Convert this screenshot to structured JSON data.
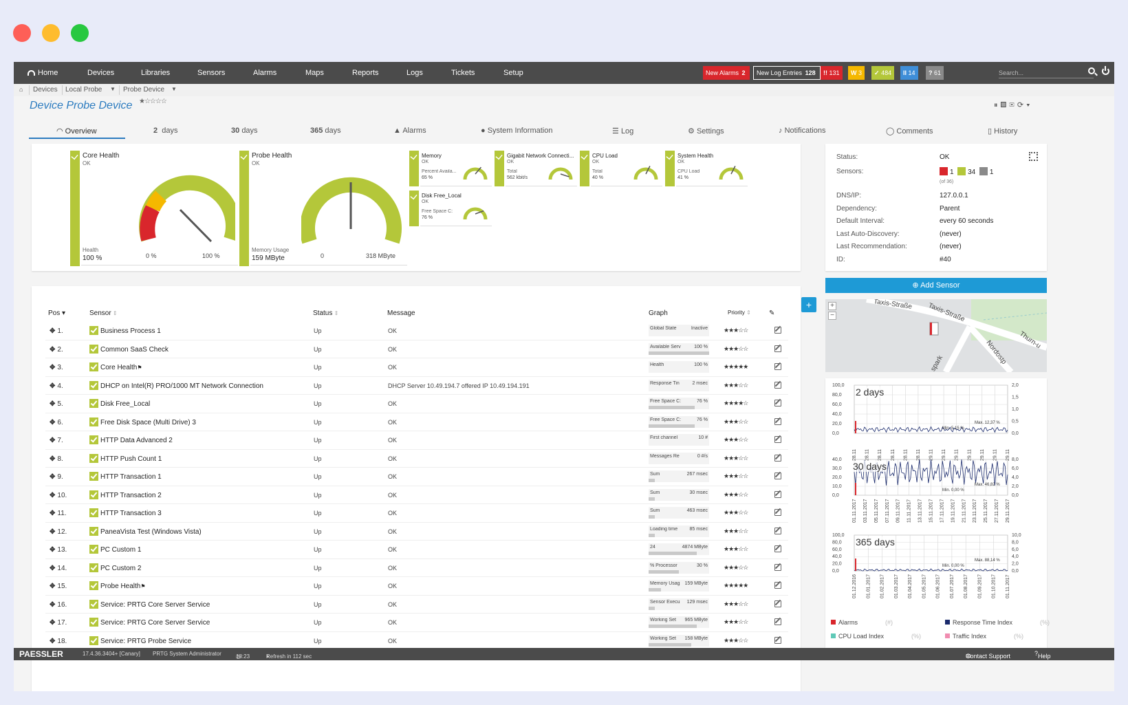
{
  "nav": {
    "items": [
      "Home",
      "Devices",
      "Libraries",
      "Sensors",
      "Alarms",
      "Maps",
      "Reports",
      "Logs",
      "Tickets",
      "Setup"
    ],
    "new_alarms_label": "New Alarms",
    "new_alarms_count": "2",
    "new_log_label": "New Log Entries",
    "new_log_count": "128",
    "badges": [
      {
        "symbol": "!!",
        "count": "131",
        "color": "#d9262c"
      },
      {
        "symbol": "W",
        "count": "3",
        "color": "#f5b800"
      },
      {
        "symbol": "✓",
        "count": "484",
        "color": "#b4c73a"
      },
      {
        "symbol": "II",
        "count": "14",
        "color": "#3f8ed8"
      },
      {
        "symbol": "?",
        "count": "61",
        "color": "#8a8a8a"
      }
    ],
    "search_placeholder": "Search..."
  },
  "breadcrumb": [
    "Devices",
    "Local Probe",
    "Probe Device"
  ],
  "page": {
    "title": "Device Probe Device",
    "stars": "★☆☆☆☆"
  },
  "tabs": [
    {
      "label": "Overview",
      "icon": "gauge-icon"
    },
    {
      "num": "2",
      "label": "days"
    },
    {
      "num": "30",
      "label": "days"
    },
    {
      "num": "365",
      "label": "days"
    },
    {
      "label": "Alarms",
      "icon": "warning-icon"
    },
    {
      "label": "System Information",
      "icon": "info-icon"
    },
    {
      "label": "Log",
      "icon": "list-icon"
    },
    {
      "label": "Settings",
      "icon": "gear-icon"
    },
    {
      "label": "Notifications",
      "icon": "bell-icon"
    },
    {
      "label": "Comments",
      "icon": "comment-icon"
    },
    {
      "label": "History",
      "icon": "history-icon"
    }
  ],
  "gauges_big": [
    {
      "name": "Core Health",
      "status": "OK",
      "channel": "Health",
      "value": "100 %",
      "min": "0 %",
      "max": "100 %",
      "fraction": 1.0
    },
    {
      "name": "Probe Health",
      "status": "OK",
      "channel": "Memory Usage",
      "value": "159 MByte",
      "min": "0",
      "max": "318 MByte",
      "fraction": 0.5
    }
  ],
  "gauges_small": [
    {
      "name": "Memory",
      "status": "OK",
      "channel": "Percent Availa...",
      "value": "65 %",
      "fraction": 0.65
    },
    {
      "name": "Gigabit Network Connecti...",
      "status": "OK",
      "channel": "Total",
      "value": "562 kbit/s",
      "fraction": 0.9
    },
    {
      "name": "CPU Load",
      "status": "OK",
      "channel": "Total",
      "value": "40 %",
      "fraction": 0.6
    },
    {
      "name": "System Health",
      "status": "OK",
      "channel": "CPU Load",
      "value": "41 %",
      "fraction": 0.6
    },
    {
      "name": "Disk Free_Local",
      "status": "OK",
      "channel": "Free Space C:",
      "value": "76 %",
      "fraction": 0.76
    }
  ],
  "table": {
    "headers": {
      "pos": "Pos",
      "sensor": "Sensor",
      "status": "Status",
      "message": "Message",
      "graph": "Graph",
      "priority": "Priority"
    },
    "rows": [
      {
        "pos": "1.",
        "name": "Business Process 1",
        "flag": "",
        "status": "Up",
        "message": "OK",
        "ch": "Global State",
        "val": "Inactive",
        "fill": 0,
        "prio": "★★★☆☆"
      },
      {
        "pos": "2.",
        "name": "Common SaaS Check",
        "flag": "",
        "status": "Up",
        "message": "OK",
        "ch": "Available Serv",
        "val": "100 %",
        "fill": 1,
        "prio": "★★★☆☆"
      },
      {
        "pos": "3.",
        "name": "Core Health",
        "flag": "⚑",
        "status": "Up",
        "message": "OK",
        "ch": "Health",
        "val": "100 %",
        "fill": 0,
        "prio": "★★★★★"
      },
      {
        "pos": "4.",
        "name": "DHCP on Intel(R) PRO/1000 MT Network Connection",
        "flag": "",
        "status": "Up",
        "message": "DHCP Server 10.49.194.7 offered IP 10.49.194.191",
        "ch": "Response Tin",
        "val": "2 msec",
        "fill": 0,
        "prio": "★★★☆☆"
      },
      {
        "pos": "5.",
        "name": "Disk Free_Local",
        "flag": "",
        "status": "Up",
        "message": "OK",
        "ch": "Free Space C:",
        "val": "76 %",
        "fill": 0.76,
        "prio": "★★★★☆"
      },
      {
        "pos": "6.",
        "name": "Free Disk Space (Multi Drive) 3",
        "flag": "",
        "status": "Up",
        "message": "OK",
        "ch": "Free Space C:",
        "val": "76 %",
        "fill": 0.76,
        "prio": "★★★☆☆"
      },
      {
        "pos": "7.",
        "name": "HTTP Data Advanced 2",
        "flag": "",
        "status": "Up",
        "message": "OK",
        "ch": "First channel",
        "val": "10 #",
        "fill": 0,
        "prio": "★★★☆☆"
      },
      {
        "pos": "8.",
        "name": "HTTP Push Count 1",
        "flag": "",
        "status": "Up",
        "message": "OK",
        "ch": "Messages Re",
        "val": "0 #/s",
        "fill": 0,
        "prio": "★★★☆☆"
      },
      {
        "pos": "9.",
        "name": "HTTP Transaction 1",
        "flag": "",
        "status": "Up",
        "message": "OK",
        "ch": "Sum",
        "val": "267 msec",
        "fill": 0.1,
        "prio": "★★★☆☆"
      },
      {
        "pos": "10.",
        "name": "HTTP Transaction 2",
        "flag": "",
        "status": "Up",
        "message": "OK",
        "ch": "Sum",
        "val": "30 msec",
        "fill": 0.1,
        "prio": "★★★☆☆"
      },
      {
        "pos": "11.",
        "name": "HTTP Transaction 3",
        "flag": "",
        "status": "Up",
        "message": "OK",
        "ch": "Sum",
        "val": "463 msec",
        "fill": 0.1,
        "prio": "★★★☆☆"
      },
      {
        "pos": "12.",
        "name": "PaneaVista Test (Windows Vista)",
        "flag": "",
        "status": "Up",
        "message": "OK",
        "ch": "Loading time",
        "val": "85 msec",
        "fill": 0.1,
        "prio": "★★★☆☆"
      },
      {
        "pos": "13.",
        "name": "PC Custom 1",
        "flag": "",
        "status": "Up",
        "message": "OK",
        "ch": "24",
        "val": "4874 MByte",
        "fill": 0.8,
        "prio": "★★★☆☆"
      },
      {
        "pos": "14.",
        "name": "PC Custom 2",
        "flag": "",
        "status": "Up",
        "message": "OK",
        "ch": "% Processor",
        "val": "30 %",
        "fill": 0.5,
        "prio": "★★★☆☆"
      },
      {
        "pos": "15.",
        "name": "Probe Health",
        "flag": "⚑",
        "status": "Up",
        "message": "OK",
        "ch": "Memory Usag",
        "val": "159 MByte",
        "fill": 0.2,
        "prio": "★★★★★"
      },
      {
        "pos": "16.",
        "name": "Service: PRTG Core Server Service",
        "flag": "",
        "status": "Up",
        "message": "OK",
        "ch": "Sensor Execu",
        "val": "129 msec",
        "fill": 0.1,
        "prio": "★★★☆☆"
      },
      {
        "pos": "17.",
        "name": "Service: PRTG Core Server Service",
        "flag": "",
        "status": "Up",
        "message": "OK",
        "ch": "Working Set",
        "val": "965 MByte",
        "fill": 0.8,
        "prio": "★★★☆☆"
      },
      {
        "pos": "18.",
        "name": "Service: PRTG Probe Service",
        "flag": "",
        "status": "Up",
        "message": "OK",
        "ch": "Working Set",
        "val": "158 MByte",
        "fill": 0.7,
        "prio": "★★★☆☆"
      }
    ]
  },
  "info": {
    "status_label": "Status:",
    "status_value": "OK",
    "sensors_label": "Sensors:",
    "sensors_down": "1",
    "sensors_up": "34",
    "sensors_unknown": "1",
    "sensors_total": "(of 36)",
    "rows": [
      {
        "k": "DNS/IP:",
        "v": "127.0.0.1"
      },
      {
        "k": "Dependency:",
        "v": "Parent"
      },
      {
        "k": "Default Interval:",
        "v": "every 60 seconds"
      },
      {
        "k": "Last Auto-Discovery:",
        "v": "(never)"
      },
      {
        "k": "Last Recommendation:",
        "v": "(never)"
      },
      {
        "k": "ID:",
        "v": "#40"
      }
    ]
  },
  "add_sensor": "Add Sensor",
  "map": {
    "zoom_in": "+",
    "zoom_out": "−",
    "street1": "Taxis-Straße",
    "street2": "Taxis-Straße",
    "street3": "Thurn-u",
    "street4": "Nordostp",
    "street5": "spark"
  },
  "graphs": {
    "g2": {
      "title": "2 days",
      "ylabels": [
        "100,0",
        "80,0",
        "60,0",
        "40,0",
        "20,0",
        "0,0"
      ],
      "y2labels": [
        "2,0",
        "1,5",
        "1,0",
        "0,5",
        "0,0"
      ],
      "xlabels": [
        "28.11",
        "28.11",
        "28.11",
        "28.11",
        "28.11",
        "28.11",
        "29.11",
        "29.11",
        "29.11",
        "29.11",
        "29.11",
        "29.11",
        "29.11"
      ],
      "min": "Min. 5,15 %",
      "max": "Max. 12,37 %"
    },
    "g30": {
      "title": "30 days",
      "ylabels": [
        "40,0",
        "30,0",
        "20,0",
        "10,0",
        "0,0"
      ],
      "y2labels": [
        "8,0",
        "6,0",
        "4,0",
        "2,0",
        "0,0"
      ],
      "xlabels": [
        "01.11.2017",
        "03.11.2017",
        "05.11.2017",
        "07.11.2017",
        "09.11.2017",
        "11.11.2017",
        "13.11.2017",
        "15.11.2017",
        "17.11.2017",
        "19.11.2017",
        "21.11.2017",
        "23.11.2017",
        "25.11.2017",
        "27.11.2017",
        "29.11.2017"
      ],
      "min": "Min. 0,00 %",
      "max": "Max. 46,82 %"
    },
    "g365": {
      "title": "365 days",
      "ylabels": [
        "100,0",
        "80,0",
        "60,0",
        "40,0",
        "20,0",
        "0,0"
      ],
      "y2labels": [
        "10,0",
        "8,0",
        "6,0",
        "4,0",
        "2,0",
        "0,0"
      ],
      "xlabels": [
        "01.12.2016",
        "01.01.2017",
        "01.02.2017",
        "01.03.2017",
        "01.04.2017",
        "01.05.2017",
        "01.06.2017",
        "01.07.2017",
        "01.08.2017",
        "01.09.2017",
        "01.10.2017",
        "01.11.2017"
      ],
      "min": "Min. 0,00 %",
      "max": "Max. 88,14 %"
    },
    "legend": [
      {
        "label": "Alarms",
        "unit": "(#)",
        "color": "#d9262c"
      },
      {
        "label": "Response Time Index",
        "unit": "(%)",
        "color": "#1a2a6c"
      },
      {
        "label": "CPU Load Index",
        "unit": "(%)",
        "color": "#5fc9b7"
      },
      {
        "label": "Traffic Index",
        "unit": "(%)",
        "color": "#f08cb0"
      }
    ]
  },
  "footer": {
    "brand": "PAESSLER",
    "version": "17.4.36.3404+ [Canary]",
    "user": "PRTG System Administrator",
    "time": "18:23",
    "refresh": "Refresh in 112 sec",
    "support": "Contact Support",
    "help": "Help"
  }
}
